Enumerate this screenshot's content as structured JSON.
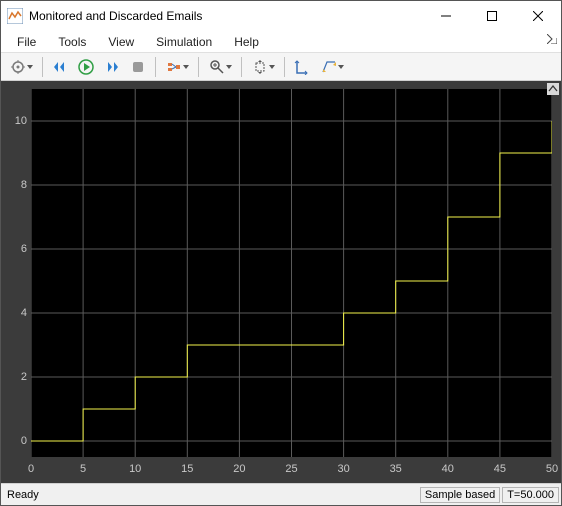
{
  "title": "Monitored and Discarded Emails",
  "menu": {
    "file": "File",
    "tools": "Tools",
    "view": "View",
    "simulation": "Simulation",
    "help": "Help"
  },
  "status": {
    "ready": "Ready",
    "mode": "Sample based",
    "time": "T=50.000"
  },
  "axes": {
    "x_ticks": [
      0,
      5,
      10,
      15,
      20,
      25,
      30,
      35,
      40,
      45,
      50
    ],
    "y_ticks": [
      0,
      2,
      4,
      6,
      8,
      10
    ],
    "y_min": -0.5,
    "y_max": 11
  },
  "chart_data": {
    "type": "line",
    "x": [
      0,
      5,
      5,
      10,
      10,
      15,
      15,
      30,
      30,
      35,
      35,
      40,
      40,
      45,
      45,
      50,
      50
    ],
    "y": [
      0,
      0,
      1,
      1,
      2,
      2,
      3,
      3,
      4,
      4,
      5,
      5,
      7,
      7,
      9,
      9,
      10
    ],
    "xlim": [
      0,
      50
    ],
    "ylim": [
      -0.5,
      11
    ],
    "xlabel": "",
    "ylabel": "",
    "title": ""
  }
}
